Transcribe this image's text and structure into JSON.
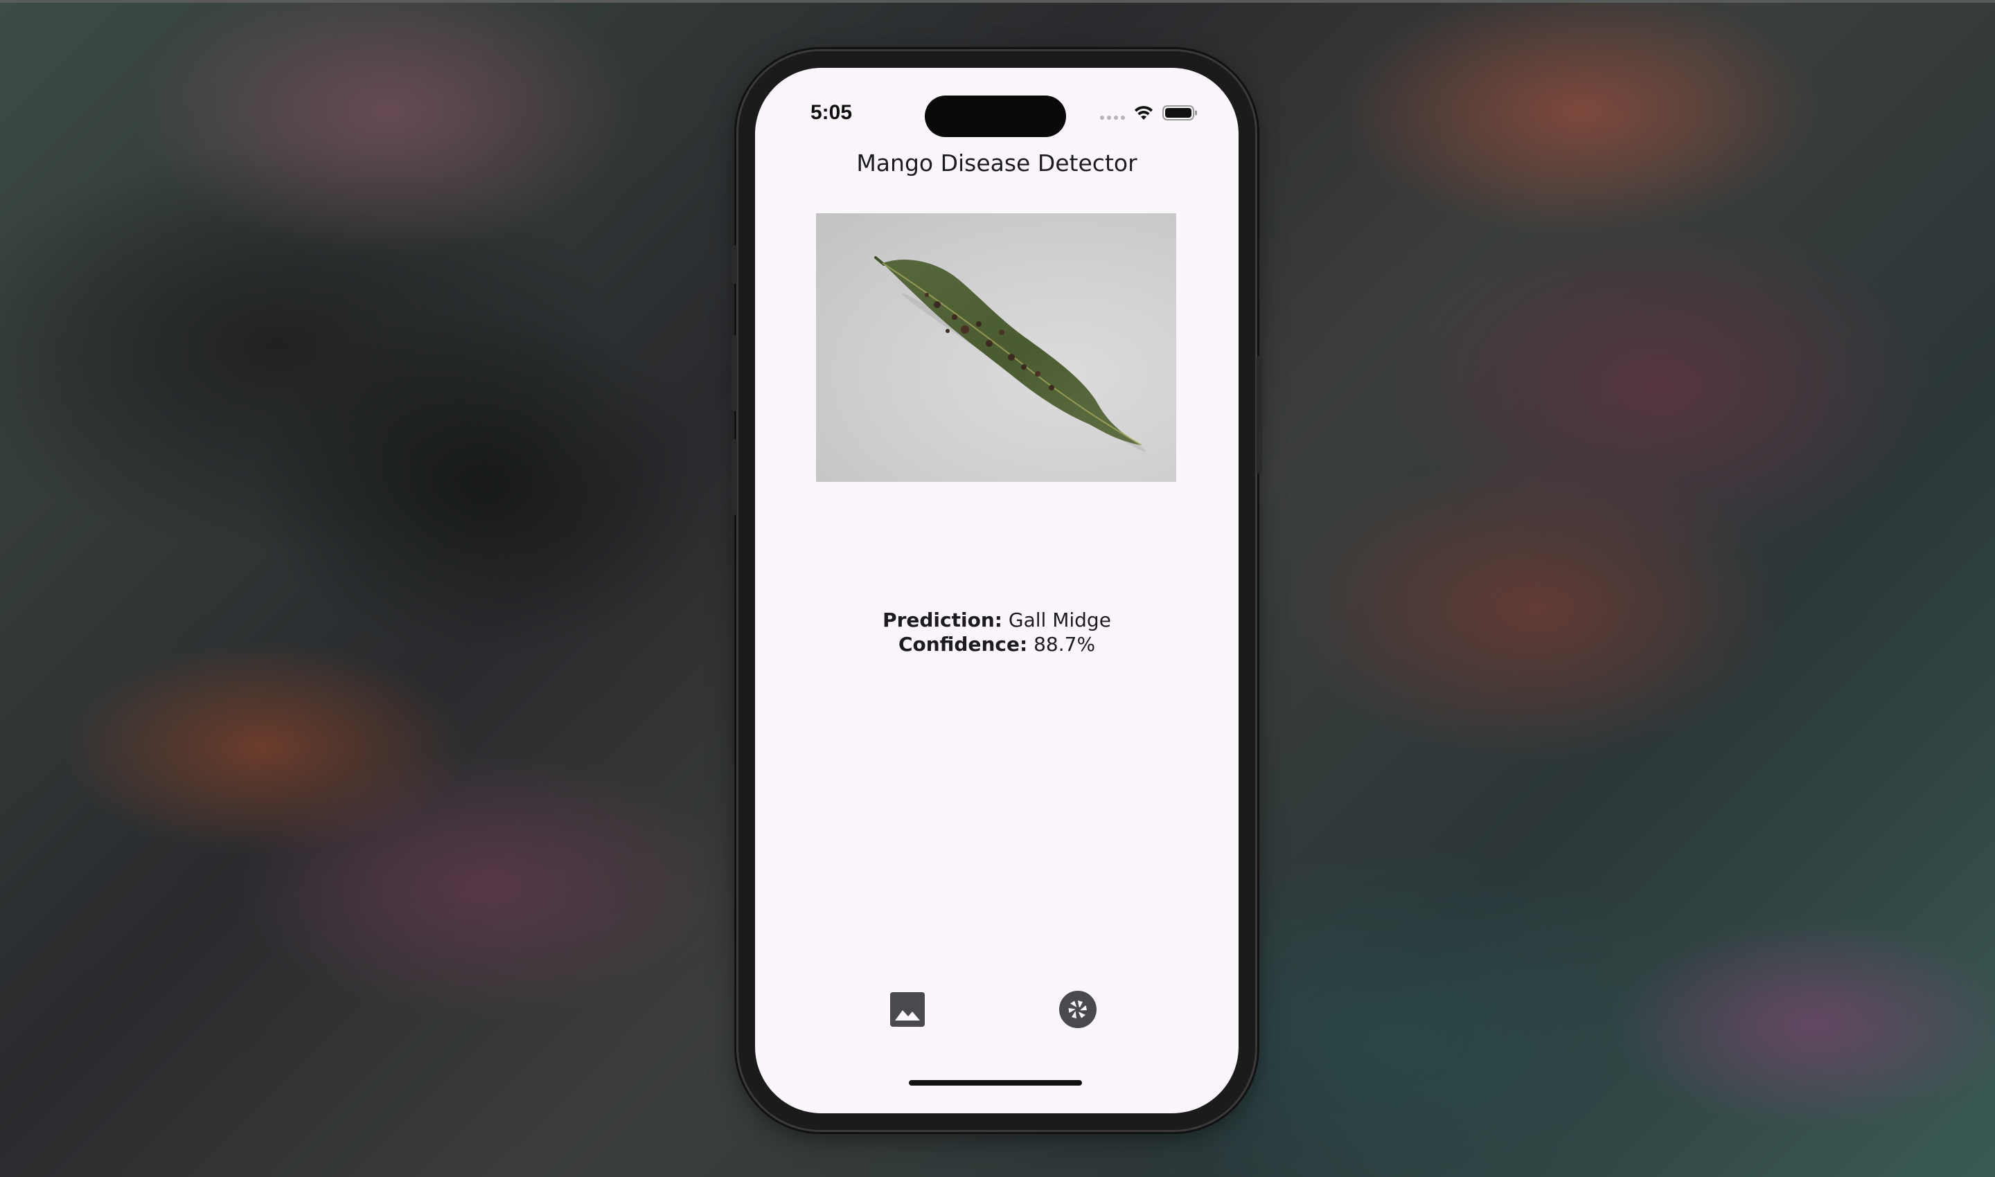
{
  "status_bar": {
    "time": "5:05",
    "icons": [
      "signal-dots-icon",
      "wifi-icon",
      "battery-icon"
    ]
  },
  "app": {
    "title": "Mango Disease Detector"
  },
  "image": {
    "subject": "mango leaf photo",
    "background_color": "#cfcfcf",
    "leaf_color": "#4b5d33"
  },
  "result": {
    "prediction_label": "Prediction:",
    "prediction_value": "Gall Midge",
    "confidence_label": "Confidence:",
    "confidence_value": "88.7%"
  },
  "bottom_bar": {
    "buttons": [
      {
        "icon": "image-gallery-icon"
      },
      {
        "icon": "camera-shutter-icon"
      }
    ],
    "icon_color": "#4a4a4e"
  },
  "colors": {
    "screen_background": "#fbf6fb",
    "text": "#1c1b1f"
  }
}
